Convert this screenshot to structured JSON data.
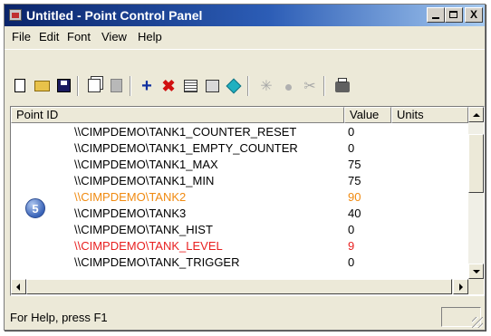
{
  "window": {
    "title": "Untitled - Point Control Panel"
  },
  "title_buttons": {
    "close": "X"
  },
  "menu": [
    "File",
    "Edit",
    "Font",
    "View",
    "Help"
  ],
  "toolbar": [
    "new",
    "open",
    "save",
    "copy",
    "paste",
    "add-point",
    "delete-point",
    "grid",
    "properties",
    "connect",
    "disabled-1",
    "disabled-2",
    "disabled-3",
    "print"
  ],
  "list": {
    "columns": [
      "Point ID",
      "Value",
      "Units"
    ],
    "rows": [
      {
        "id": "\\\\CIMPDEMO\\TANK1_COUNTER_RESET",
        "value": "0",
        "color": "#000000"
      },
      {
        "id": "\\\\CIMPDEMO\\TANK1_EMPTY_COUNTER",
        "value": "0",
        "color": "#000000"
      },
      {
        "id": "\\\\CIMPDEMO\\TANK1_MAX",
        "value": "75",
        "color": "#000000"
      },
      {
        "id": "\\\\CIMPDEMO\\TANK1_MIN",
        "value": "75",
        "color": "#000000"
      },
      {
        "id": "\\\\CIMPDEMO\\TANK2",
        "value": "90",
        "color": "#f08a10"
      },
      {
        "id": "\\\\CIMPDEMO\\TANK3",
        "value": "40",
        "color": "#000000"
      },
      {
        "id": "\\\\CIMPDEMO\\TANK_HIST",
        "value": "0",
        "color": "#000000"
      },
      {
        "id": "\\\\CIMPDEMO\\TANK_LEVEL",
        "value": "9",
        "color": "#e82020"
      },
      {
        "id": "\\\\CIMPDEMO\\TANK_TRIGGER",
        "value": "0",
        "color": "#000000"
      }
    ],
    "badge": "5"
  },
  "status": {
    "text": "For Help, press F1"
  }
}
